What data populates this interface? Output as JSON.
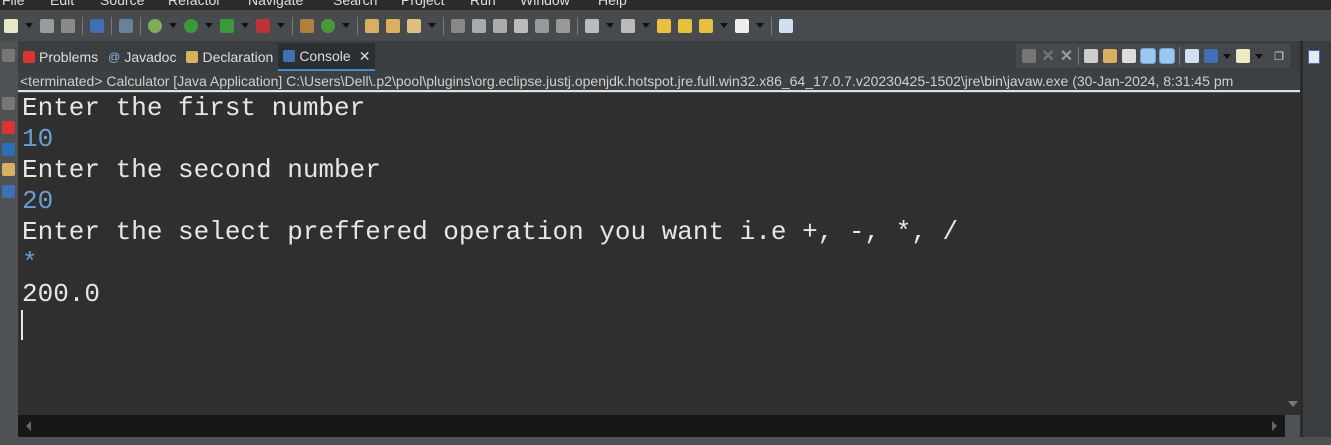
{
  "menu": [
    "File",
    "Edit",
    "Source",
    "Refactor",
    "Navigate",
    "Search",
    "Project",
    "Run",
    "Window",
    "Help"
  ],
  "tabs": [
    {
      "label": "Problems",
      "icon": "problems-icon"
    },
    {
      "label": "Javadoc",
      "icon": "javadoc-at-icon"
    },
    {
      "label": "Declaration",
      "icon": "declaration-icon"
    },
    {
      "label": "Console",
      "icon": "console-icon",
      "active": true
    }
  ],
  "console": {
    "header": "<terminated> Calculator [Java Application] C:\\Users\\Dell\\.p2\\pool\\plugins\\org.eclipse.justj.openjdk.hotspot.jre.full.win32.x86_64_17.0.7.v20230425-1502\\jre\\bin\\javaw.exe  (30-Jan-2024, 8:31:45 pm",
    "lines": [
      {
        "text": "Enter the first number",
        "input": false
      },
      {
        "text": "10",
        "input": true
      },
      {
        "text": "Enter the second number",
        "input": false
      },
      {
        "text": "20",
        "input": true
      },
      {
        "text": "Enter the select preffered operation you want i.e +, -, *, /",
        "input": false
      },
      {
        "text": "*",
        "input": true
      },
      {
        "text": "200.0",
        "input": false
      }
    ]
  },
  "colors": {
    "console_bg": "#2f2f2f",
    "input_text": "#6a9ed2",
    "output_text": "#e6e6e6",
    "active_tab_underline": "#4a8cc7"
  }
}
